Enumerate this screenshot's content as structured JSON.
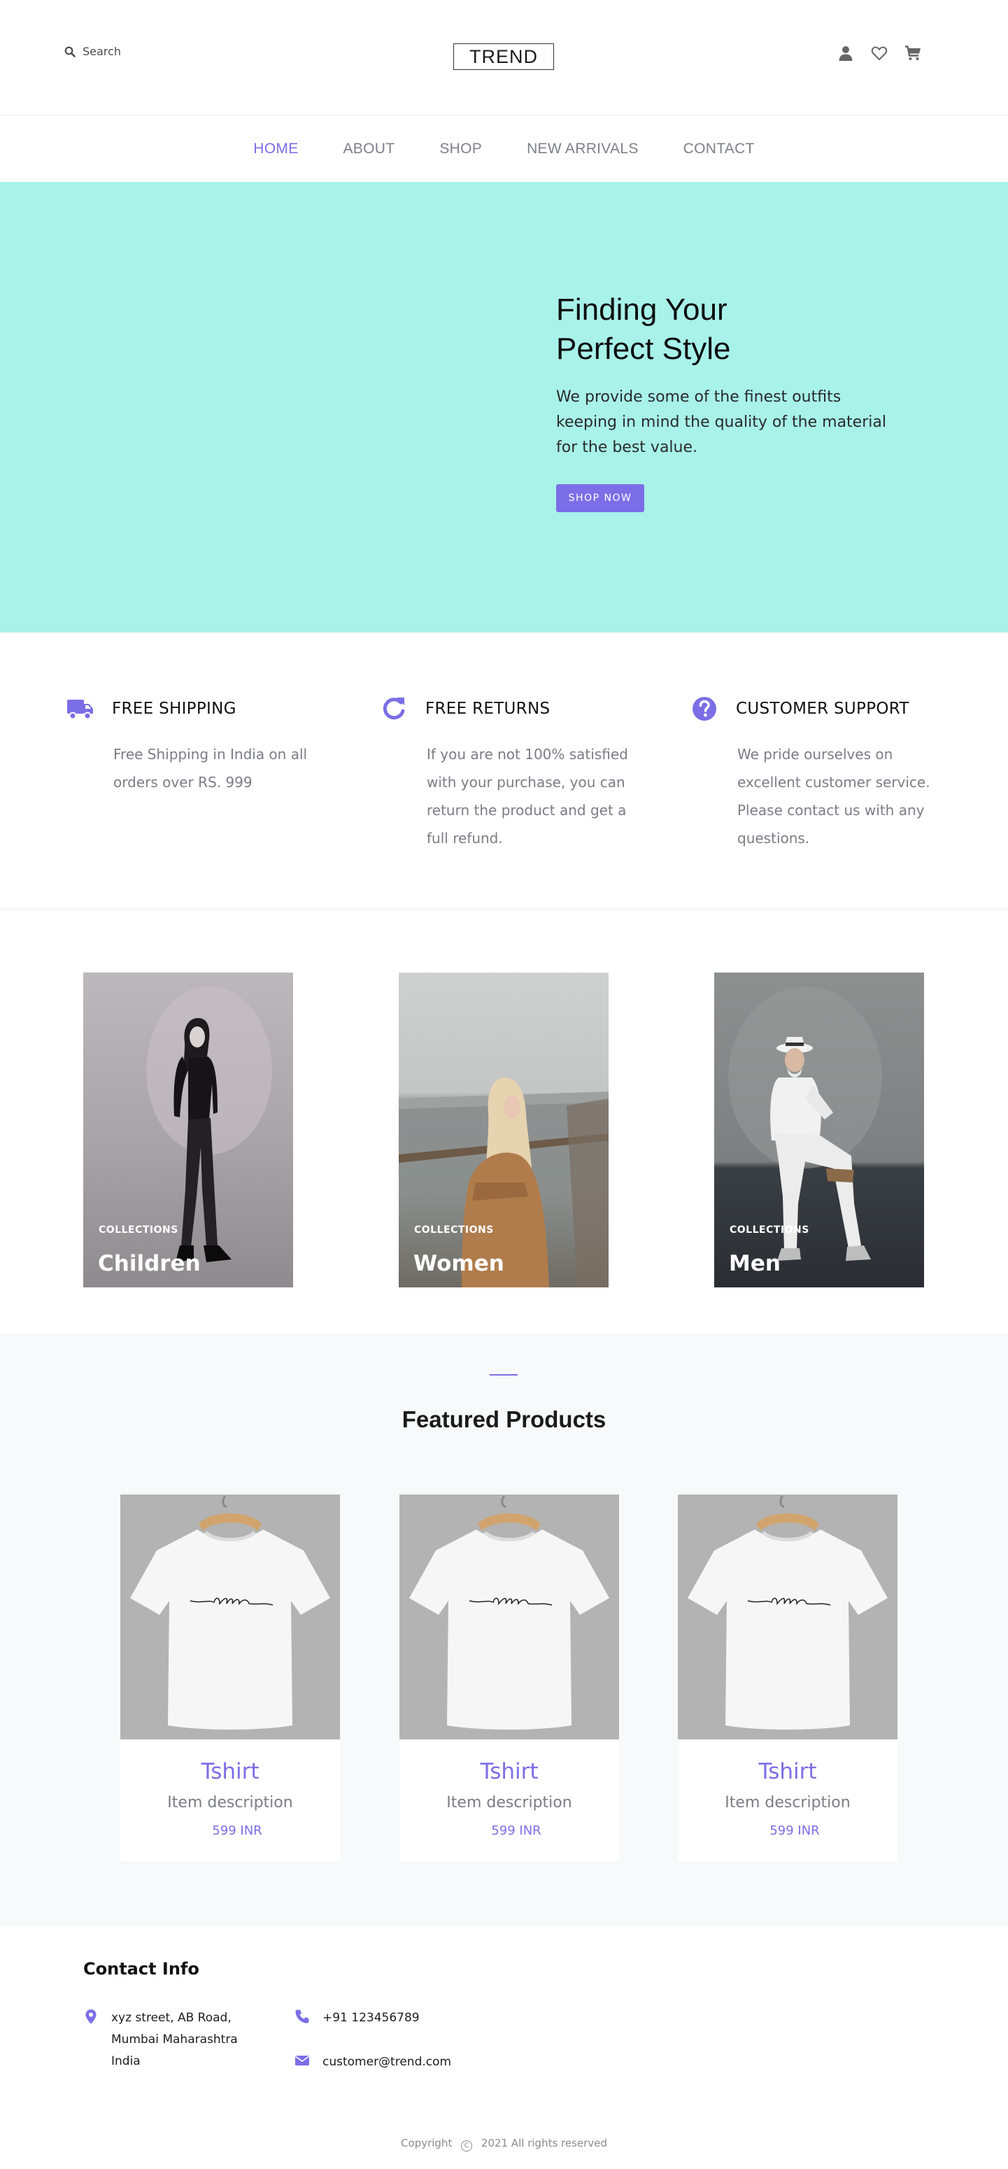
{
  "colors": {
    "accent": "#7b6ee6",
    "hero_bg": "#a8f2ea",
    "section_bg": "#f8f9fa"
  },
  "header": {
    "search_label": "Search",
    "logo": "TREND",
    "icons": [
      "user-icon",
      "heart-icon",
      "cart-icon"
    ]
  },
  "nav": {
    "items": [
      {
        "label": "HOME",
        "active": true
      },
      {
        "label": "ABOUT"
      },
      {
        "label": "SHOP"
      },
      {
        "label": "NEW ARRIVALS"
      },
      {
        "label": "CONTACT"
      }
    ]
  },
  "hero": {
    "title_line1": "Finding Your",
    "title_line2": "Perfect Style",
    "text": "We provide some of the finest outfits keeping in mind the quality of the material for the best value.",
    "button": "SHOP NOW"
  },
  "features": [
    {
      "icon": "truck-icon",
      "title": "FREE SHIPPING",
      "desc": "Free Shipping in India on all orders over RS. 999"
    },
    {
      "icon": "refresh-icon",
      "title": "FREE RETURNS",
      "desc": "If you are not 100% satisfied with your purchase, you can return the product and get a full refund."
    },
    {
      "icon": "question-circle-icon",
      "title": "CUSTOMER SUPPORT",
      "desc": "We pride ourselves on excellent customer service. Please contact us with any questions."
    }
  ],
  "collections": [
    {
      "tag": "COLLECTIONS",
      "name": "Children"
    },
    {
      "tag": "COLLECTIONS",
      "name": "Women"
    },
    {
      "tag": "COLLECTIONS",
      "name": "Men"
    }
  ],
  "featured": {
    "heading": "Featured Products",
    "products": [
      {
        "name": "Tshirt",
        "desc": "Item description",
        "price": "599 INR",
        "print": "smile"
      },
      {
        "name": "Tshirt",
        "desc": "Item description",
        "price": "599 INR",
        "print": "smile"
      },
      {
        "name": "Tshirt",
        "desc": "Item description",
        "price": "599 INR",
        "print": "smile"
      }
    ]
  },
  "contact": {
    "heading": "Contact Info",
    "address": [
      "xyz street, AB Road,",
      "Mumbai Maharashtra",
      "India"
    ],
    "phone": "+91 123456789",
    "email": "customer@trend.com"
  },
  "footer": {
    "copyright": "Copyright",
    "year_text": "2021 All rights reserved"
  }
}
